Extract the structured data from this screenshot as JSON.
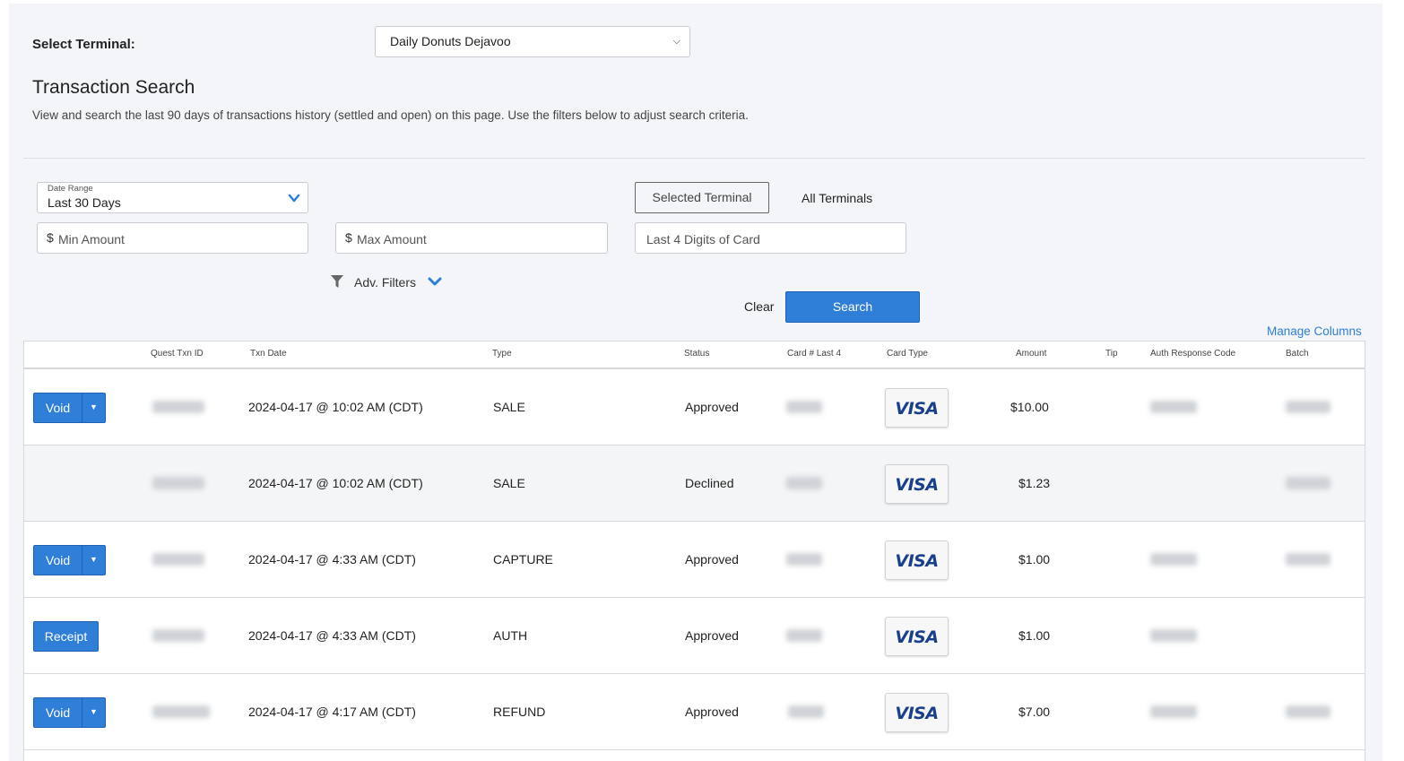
{
  "terminal": {
    "label": "Select Terminal:",
    "selected": "Daily Donuts Dejavoo"
  },
  "page": {
    "title": "Transaction Search",
    "description": "View and search the last 90 days of transactions history (settled and open) on this page. Use the filters below to adjust search criteria."
  },
  "filters": {
    "date_range_label": "Date Range",
    "date_range_value": "Last 30 Days",
    "currency_symbol": "$",
    "min_amount_placeholder": "Min Amount",
    "max_amount_placeholder": "Max Amount",
    "card_digits_placeholder": "Last 4 Digits of Card",
    "terminal_scope_selected": "Selected Terminal",
    "terminal_scope_all": "All Terminals",
    "adv_filters_label": "Adv. Filters",
    "clear_label": "Clear",
    "search_label": "Search",
    "manage_columns_label": "Manage Columns"
  },
  "table": {
    "columns": [
      "Quest Txn ID",
      "Txn Date",
      "Type",
      "Status",
      "Card # Last 4",
      "Card Type",
      "Amount",
      "Tip",
      "Auth Response Code",
      "Batch"
    ],
    "rows": [
      {
        "action": "Void",
        "date": "2024-04-17 @ 10:02 AM (CDT)",
        "type": "SALE",
        "status": "Approved",
        "card_type": "VISA",
        "amount": "$10.00"
      },
      {
        "action": "",
        "date": "2024-04-17 @ 10:02 AM (CDT)",
        "type": "SALE",
        "status": "Declined",
        "card_type": "VISA",
        "amount": "$1.23"
      },
      {
        "action": "Void",
        "date": "2024-04-17 @ 4:33 AM (CDT)",
        "type": "CAPTURE",
        "status": "Approved",
        "card_type": "VISA",
        "amount": "$1.00"
      },
      {
        "action": "Receipt",
        "date": "2024-04-17 @ 4:33 AM (CDT)",
        "type": "AUTH",
        "status": "Approved",
        "card_type": "VISA",
        "amount": "$1.00"
      },
      {
        "action": "Void",
        "date": "2024-04-17 @ 4:17 AM (CDT)",
        "type": "REFUND",
        "status": "Approved",
        "card_type": "VISA",
        "amount": "$7.00"
      }
    ]
  },
  "colors": {
    "accent": "#2f7ed8",
    "panel_bg": "#f3f5f8",
    "visa_blue": "#1a3f8c"
  }
}
